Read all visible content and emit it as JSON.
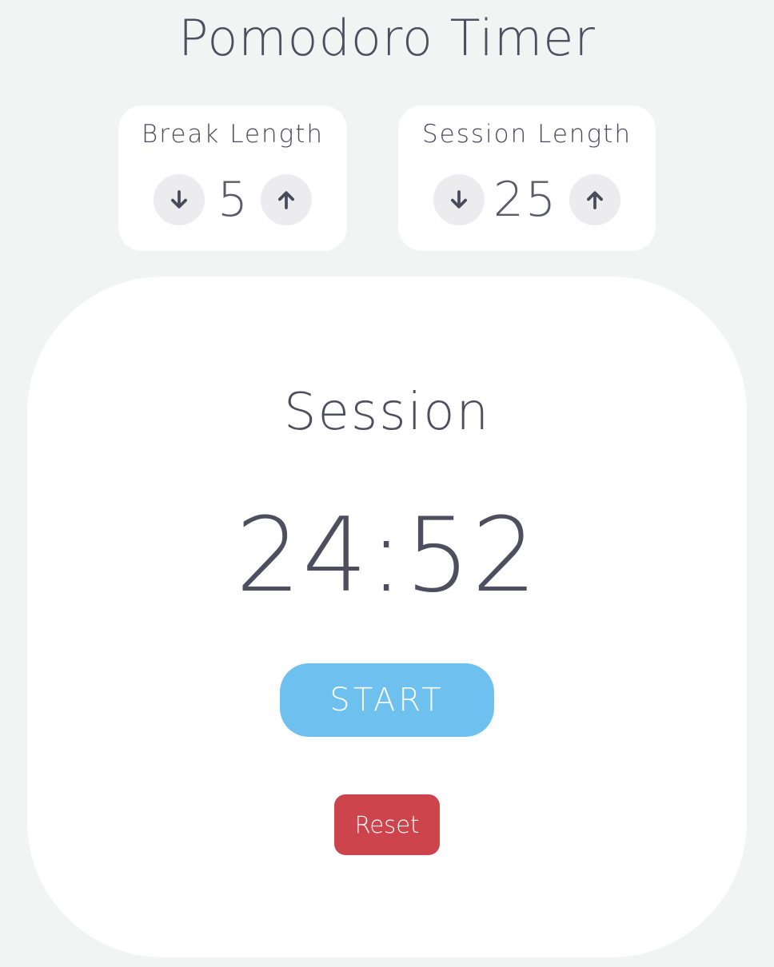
{
  "app": {
    "title": "Pomodoro Timer"
  },
  "break": {
    "label": "Break Length",
    "value": "5",
    "decrement_icon": "arrow-down-icon",
    "increment_icon": "arrow-up-icon"
  },
  "session": {
    "label": "Session Length",
    "value": "25",
    "decrement_icon": "arrow-down-icon",
    "increment_icon": "arrow-up-icon"
  },
  "timer": {
    "label": "Session",
    "time_left": "24:52",
    "start_label": "START",
    "reset_label": "Reset"
  },
  "colors": {
    "background": "#f2f4f4",
    "card": "#ffffff",
    "text": "#4e4e5f",
    "round_button": "#ececee",
    "start_button": "#6ec1ef",
    "reset_button": "#cd444c"
  }
}
